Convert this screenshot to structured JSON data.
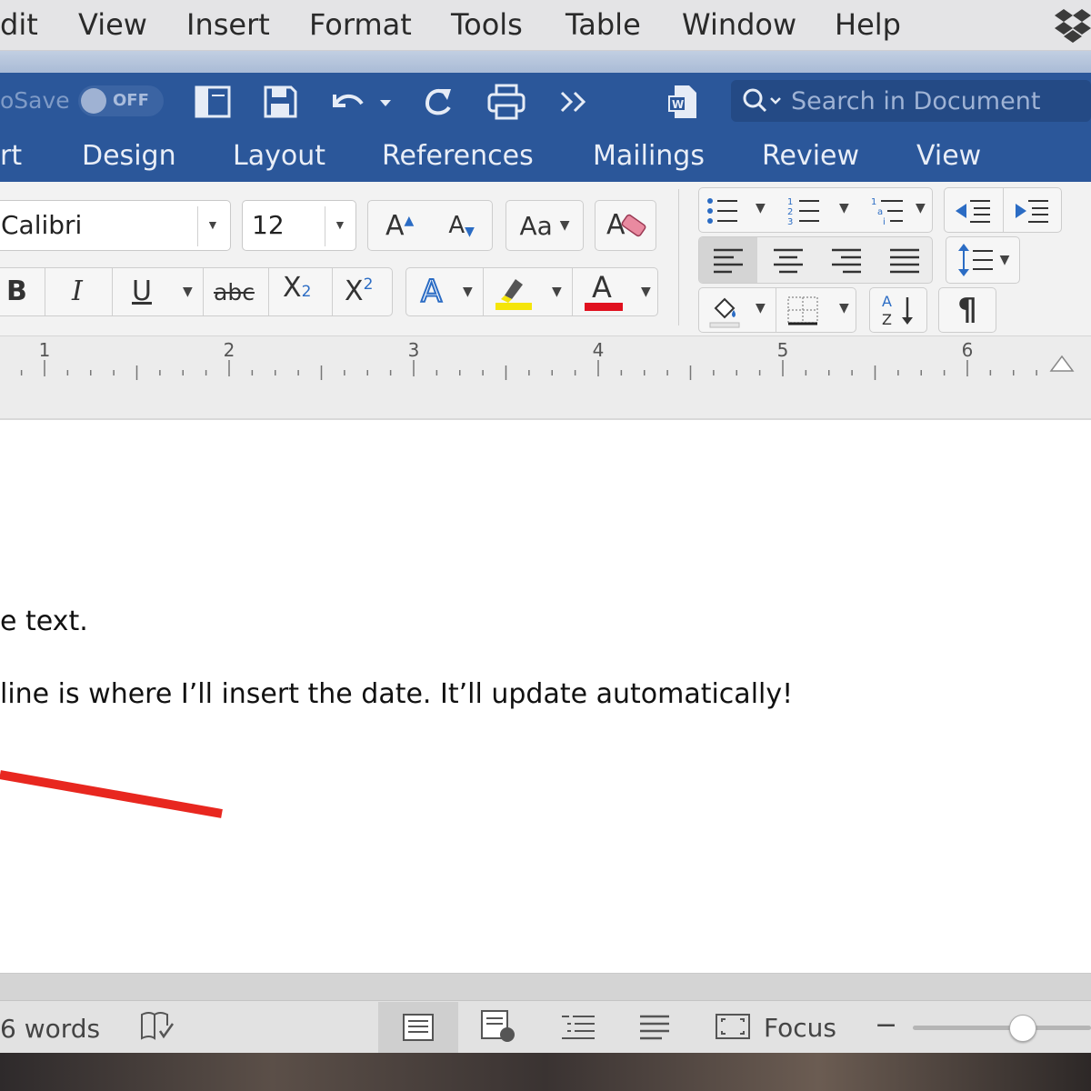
{
  "menu_bar": {
    "items": [
      "dit",
      "View",
      "Insert",
      "Format",
      "Tools",
      "Table",
      "Window",
      "Help"
    ]
  },
  "quick_access": {
    "autosave_label": "oSave",
    "autosave_state": "OFF",
    "search_placeholder": "Search in Document"
  },
  "ribbon_tabs": [
    "rt",
    "Design",
    "Layout",
    "References",
    "Mailings",
    "Review",
    "View"
  ],
  "font": {
    "name": "Calibri",
    "size": "12",
    "bold": "B",
    "italic": "I",
    "underline": "U",
    "strike": "abc",
    "subscript": "X",
    "subscript_sub": "2",
    "superscript": "X",
    "superscript_sup": "2",
    "grow": "A",
    "shrink": "A",
    "change_case": "Aa",
    "text_effects": "A",
    "font_color": "A",
    "highlight_color": "#f5e50a",
    "font_color_value": "#e0101e"
  },
  "paragraph": {
    "show_marks": "¶"
  },
  "ruler": {
    "numbers": [
      "1",
      "2",
      "3",
      "4",
      "5",
      "6"
    ]
  },
  "document": {
    "line1": "e text.",
    "line2": "line is where I’ll insert the date. It’ll update automatically!",
    "annotation_color": "#e8271f"
  },
  "status_bar": {
    "word_count": "6 words",
    "focus_label": "Focus",
    "zoom_minus": "−"
  }
}
